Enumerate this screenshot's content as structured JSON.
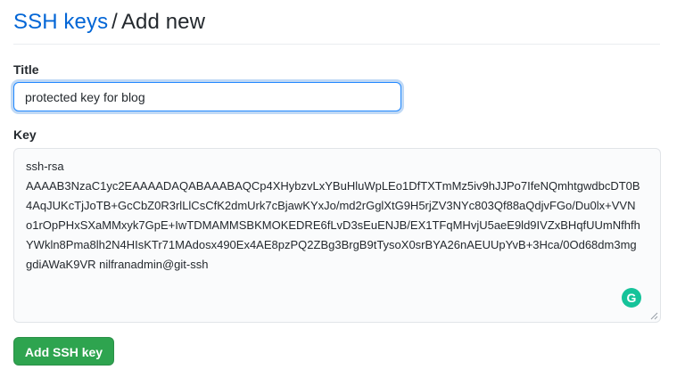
{
  "header": {
    "breadcrumb_link": "SSH keys",
    "separator": "/",
    "current": "Add new"
  },
  "form": {
    "title_label": "Title",
    "title_value": "protected key for blog",
    "key_label": "Key",
    "key_lines": [
      "ssh-rsa",
      "AAAAB3NzaC1yc2EAAAADAQABAAABAQCp4XHybzvLxYBuHluWpLEo1DfTXTmMz5iv9hJJPo7IfeNQmhtgwdbcDT0B",
      "4AqJUKcTjJoTB+GcCbZ0R3rlLlCsCfK2dmUrk7cBjawKYxJo/md2rGglXtG9H5rjZV3NYc803Qf88aQdjvFGo/Du0lx+VVN",
      "o1rOpPHxSXaMMxyk7GpE+IwTDMAMMSBKMOKEDRE6fLvD3sEuENJB/EX1TFqMHvjU5aeE9ld9IVZxBHqfUUmNfhfh",
      "YWkln8Pma8lh2N4HIsKTr71MAdosx490Ex4AE8pzPQ2ZBg3BrgB9tTysoX0srBYA26nAEUUpYvB+3Hca/0Od68dm3mg",
      "gdiAWaK9VR nilfranadmin@git-ssh"
    ],
    "submit_label": "Add SSH key"
  },
  "icons": {
    "grammarly": "grammarly-icon",
    "grammarly_glyph": "G",
    "resize": "resize-handle-icon"
  },
  "colors": {
    "link": "#0366d6",
    "button": "#2ea44f",
    "focus_border": "#2188ff",
    "grammarly": "#15c39a"
  }
}
